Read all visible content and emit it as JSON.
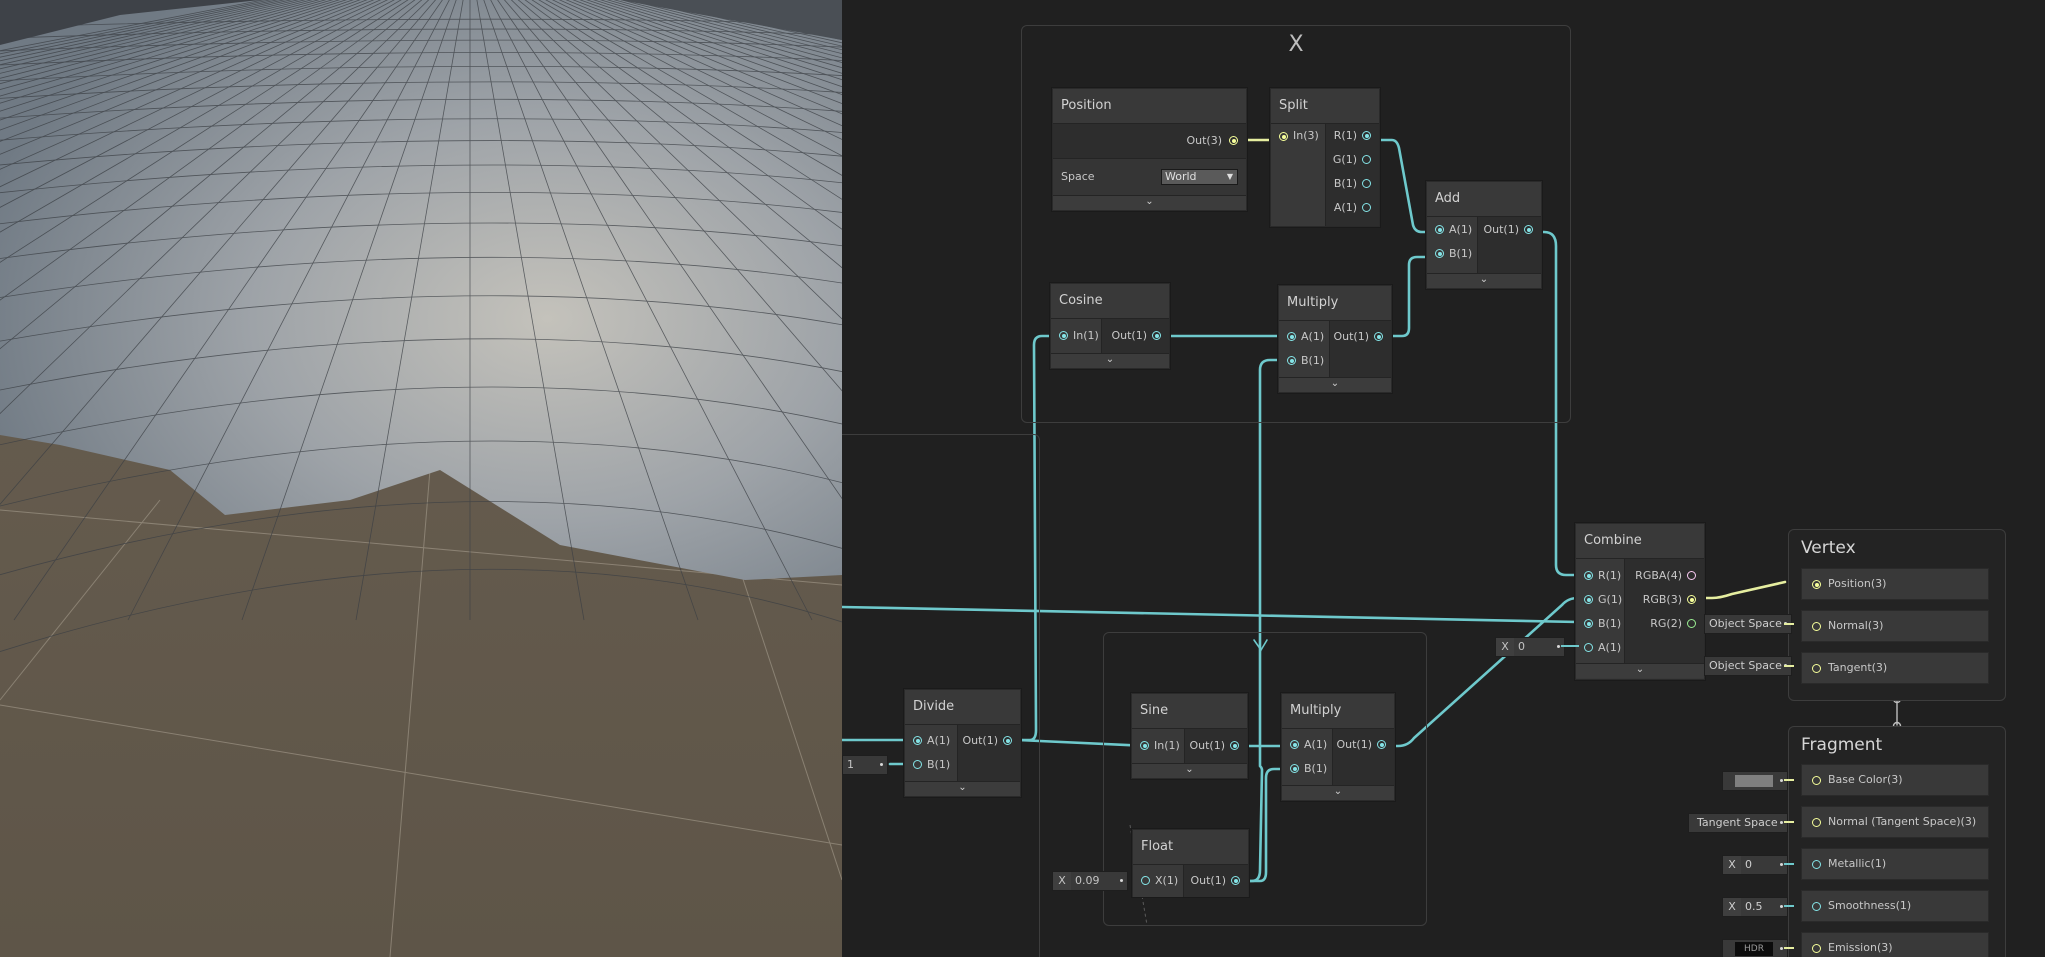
{
  "groups": {
    "top": {
      "title": "X"
    }
  },
  "nodes": {
    "position": {
      "title": "Position",
      "out": "Out(3)",
      "space_label": "Space",
      "space_value": "World"
    },
    "split": {
      "title": "Split",
      "in": "In(3)",
      "outs": [
        "R(1)",
        "G(1)",
        "B(1)",
        "A(1)"
      ]
    },
    "add": {
      "title": "Add",
      "ins": [
        "A(1)",
        "B(1)"
      ],
      "out": "Out(1)"
    },
    "cosine": {
      "title": "Cosine",
      "in": "In(1)",
      "out": "Out(1)"
    },
    "multiply_top": {
      "title": "Multiply",
      "ins": [
        "A(1)",
        "B(1)"
      ],
      "out": "Out(1)"
    },
    "combine": {
      "title": "Combine",
      "ins": [
        "R(1)",
        "G(1)",
        "B(1)",
        "A(1)"
      ],
      "outs": [
        "RGBA(4)",
        "RGB(3)",
        "RG(2)"
      ],
      "a_x": "X",
      "a_value": "0"
    },
    "divide": {
      "title": "Divide",
      "ins": [
        "A(1)",
        "B(1)"
      ],
      "out": "Out(1)",
      "b_value": "1"
    },
    "sine": {
      "title": "Sine",
      "in": "In(1)",
      "out": "Out(1)"
    },
    "multiply_bottom": {
      "title": "Multiply",
      "ins": [
        "A(1)",
        "B(1)"
      ],
      "out": "Out(1)"
    },
    "float": {
      "title": "Float",
      "in": "X(1)",
      "out": "Out(1)",
      "x_label": "X",
      "x_value": "0.09"
    }
  },
  "master": {
    "vertex": {
      "title": "Vertex",
      "slots": [
        "Position(3)",
        "Normal(3)",
        "Tangent(3)"
      ],
      "normal_space": "Object Space",
      "tangent_space": "Object Space"
    },
    "fragment": {
      "title": "Fragment",
      "slots": [
        "Base Color(3)",
        "Normal (Tangent Space)(3)",
        "Metallic(1)",
        "Smoothness(1)",
        "Emission(3)"
      ],
      "normal_space": "Tangent Space",
      "metallic_x": "X",
      "metallic_value": "0",
      "smoothness_x": "X",
      "smoothness_value": "0.5",
      "emission_label": "HDR"
    }
  },
  "colors": {
    "float_port": "#84e4e7",
    "vector3_port": "#f6ff9a",
    "vector4_port": "#fbcbf4",
    "vector2_port": "#9aef92",
    "graph_bg": "#202020"
  }
}
